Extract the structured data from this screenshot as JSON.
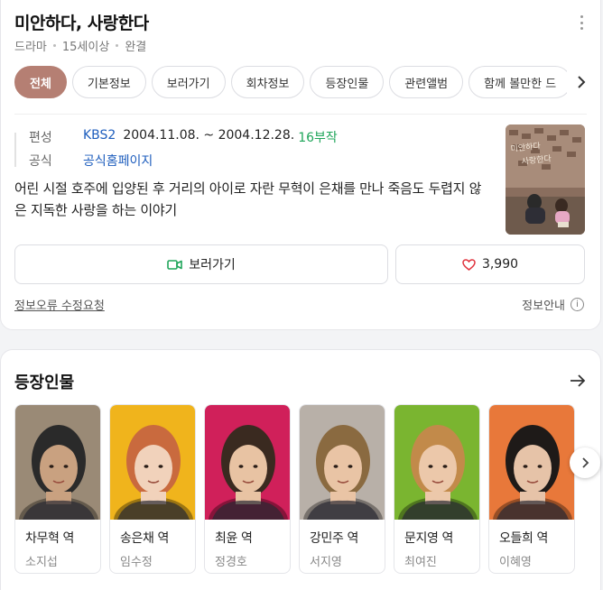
{
  "header": {
    "title": "미안하다, 사랑한다",
    "meta": [
      "드라마",
      "15세이상",
      "완결"
    ]
  },
  "tabs": [
    "전체",
    "기본정보",
    "보러가기",
    "회차정보",
    "등장인물",
    "관련앨범",
    "함께 볼만한 드"
  ],
  "info": {
    "network_label": "편성",
    "network": "KBS2",
    "period": "2004.11.08. ~ 2004.12.28.",
    "episodes": "16부작",
    "official_label": "공식",
    "official_link": "공식홈페이지",
    "description": "어린 시절 호주에 입양된 후 거리의 아이로 자란 무혁이 은채를 만나 죽음도 두렵지 않은 지독한 사랑을 하는 이야기"
  },
  "actions": {
    "watch_label": "보러가기",
    "like_count": "3,990"
  },
  "footer": {
    "report_label": "정보오류 수정요청",
    "notice_label": "정보안내",
    "notice_icon": "i"
  },
  "cast_section": {
    "title": "등장인물",
    "members": [
      {
        "role": "차무혁 역",
        "actor": "소지섭",
        "bg": "#9a8a76",
        "hair": "#2a2a2a",
        "skin": "#c9a180"
      },
      {
        "role": "송은채 역",
        "actor": "임수정",
        "bg": "#f0b41c",
        "hair": "#c96a3e",
        "skin": "#f1d2bb"
      },
      {
        "role": "최윤 역",
        "actor": "정경호",
        "bg": "#d0205a",
        "hair": "#3a2a20",
        "skin": "#e8c3a3"
      },
      {
        "role": "강민주 역",
        "actor": "서지영",
        "bg": "#b8b0a8",
        "hair": "#8a6a40",
        "skin": "#e9c4a5"
      },
      {
        "role": "문지영 역",
        "actor": "최여진",
        "bg": "#7ab530",
        "hair": "#c28a4a",
        "skin": "#ecc8aa"
      },
      {
        "role": "오들희 역",
        "actor": "이혜영",
        "bg": "#e8783a",
        "hair": "#1e1a18",
        "skin": "#e6c3a8"
      }
    ]
  },
  "colors": {
    "accent_tab": "#b57f73",
    "link": "#1d5dbd",
    "episodes": "#1fa55a",
    "heart": "#e0323c",
    "video_icon": "#1fa55a"
  }
}
